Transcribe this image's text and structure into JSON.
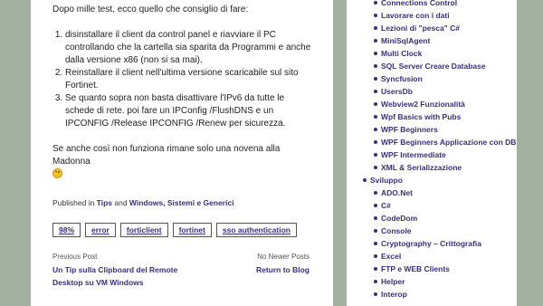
{
  "article": {
    "intro": "Dopo mille test, ecco quello che consiglio di fare:",
    "steps": [
      "disinstallare il client da control panel e riavviare il PC controllando che la cartella sia sparita da Programmi e anche dalla versione x86 (non si sa mai).",
      "Reinstallare il client nell'ultima versione scaricabile sul sito Fortinet.",
      "Se quanto sopra non basta disattivare l'IPv6 da tutte le schede di rete. poi fare un IPConfig /FlushDNS e un IPCONFIG /Release IPCONFIG /Renew per sicurezza."
    ],
    "closing": "Se anche così non funziona rimane solo una novena alla Madonna",
    "emoji": "wink-emoji"
  },
  "meta": {
    "published_prefix": "Published in ",
    "category1": "Tips",
    "and": " and ",
    "category2": "Windows, Sistemi e Generici"
  },
  "tags": [
    "98%",
    "error",
    "forticlient",
    "fortinet",
    "sso authentication"
  ],
  "post_nav": {
    "prev_label": "Previous Post",
    "prev_title": "Un Tip sulla Clipboard del Remote Desktop su VM Windows",
    "next_label": "No Newer Posts",
    "next_title": "Return to Blog"
  },
  "sidebar": {
    "group1_items": [
      "Connections Control",
      "Lavorare con i dati",
      "Lezioni di \"pesca\" C#",
      "MiniSqlAgent",
      "Multi Clock",
      "SQL Server Creare Database",
      "Syncfusion",
      "UsersDb",
      "Webview2 Funzionalità",
      "Wpf Basics with Pubs",
      "WPF Beginners",
      "WPF Beginners Applicazione con DB",
      "WPF Intermediate",
      "XML & Serializzazione"
    ],
    "group2_title": "Sviluppo",
    "group2_items": [
      "ADO.Net",
      "C#",
      "CodeDom",
      "Console",
      "Cryptography – Crittografia",
      "Excel",
      "FTP e WEB Clients",
      "Helper",
      "Interop"
    ]
  },
  "colors": {
    "background": "#a3b1a0",
    "link": "#3b2f7a",
    "card": "#ffffff"
  }
}
